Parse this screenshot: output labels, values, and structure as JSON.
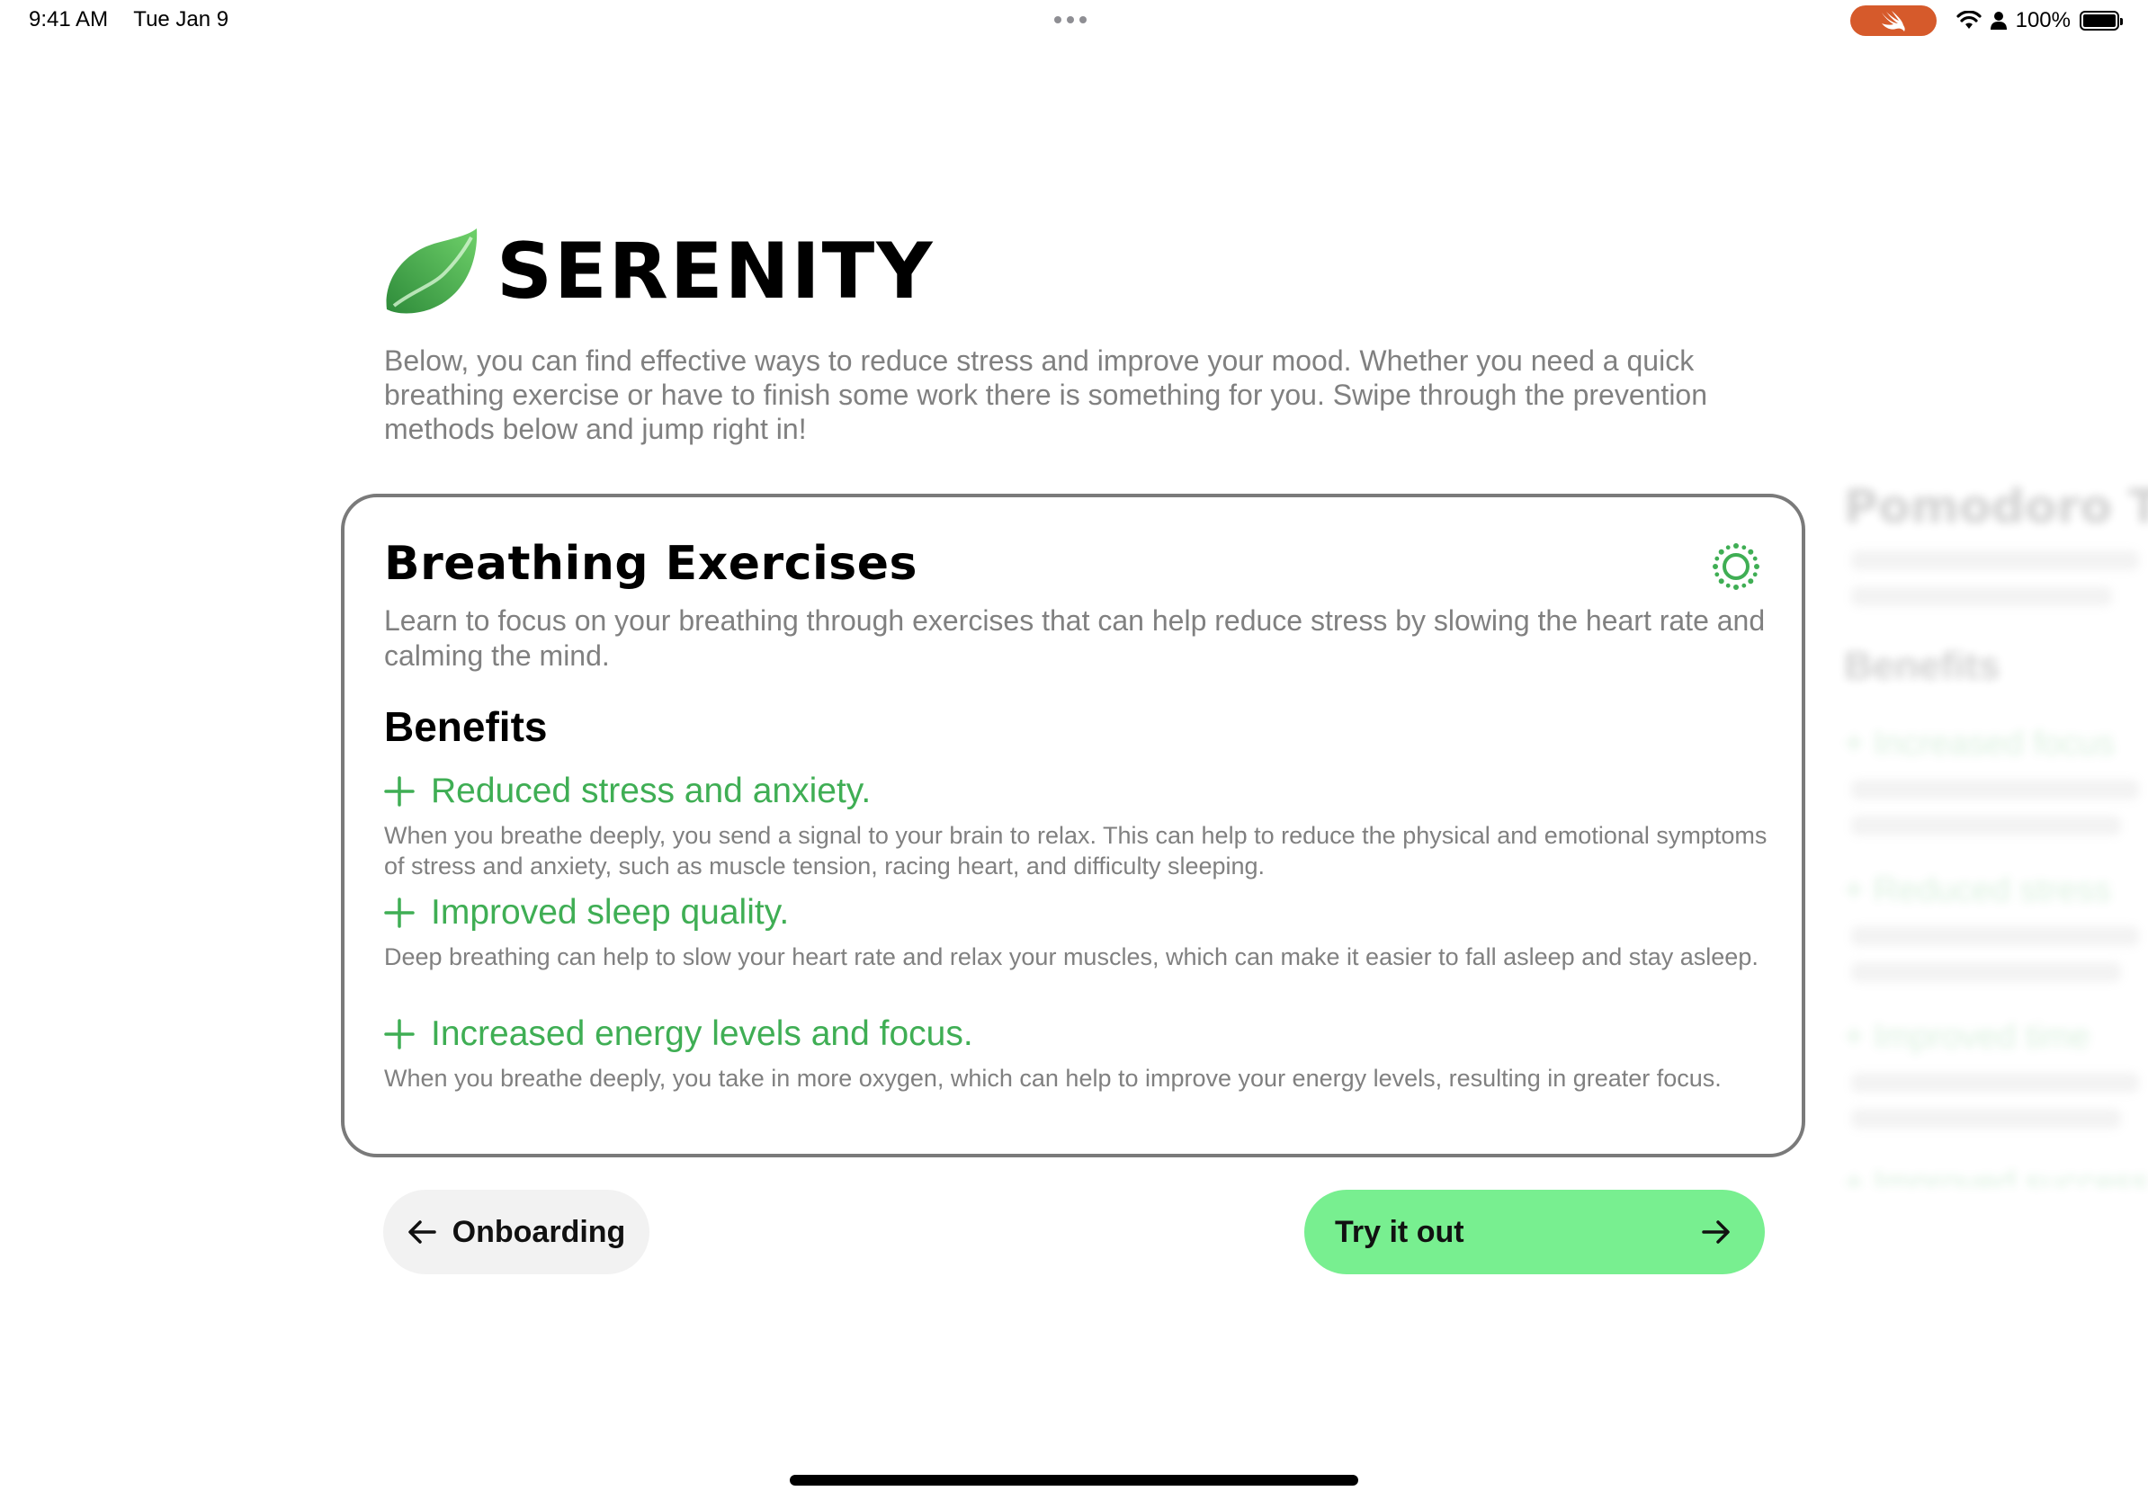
{
  "status_bar": {
    "time": "9:41 AM",
    "date": "Tue Jan 9",
    "battery": "100%"
  },
  "header": {
    "app_name": "SERENITY",
    "intro": "Below, you can find effective ways to reduce stress and improve your mood. Whether you need a quick breathing exercise or have to finish some work there is something for you. Swipe through the prevention methods below and jump right in!"
  },
  "card": {
    "title": "Breathing Exercises",
    "description": "Learn to focus on your breathing through exercises that can help reduce stress by slowing the heart rate and calming the mind.",
    "benefits_heading": "Benefits",
    "benefits": [
      {
        "title": "Reduced stress and anxiety.",
        "text": "When you breathe deeply, you send a signal to your brain to relax. This can help to reduce the physical and emotional symptoms of stress and anxiety, such as muscle tension, racing heart, and difficulty sleeping."
      },
      {
        "title": "Improved sleep quality.",
        "text": "Deep breathing can help to slow your heart rate and relax your muscles, which can make it easier to fall asleep and stay asleep."
      },
      {
        "title": "Increased energy levels and focus.",
        "text": "When you breathe deeply, you take in more oxygen, which can help to improve your energy levels, resulting in greater focus."
      }
    ]
  },
  "buttons": {
    "back_label": "Onboarding",
    "try_label": "Try it out"
  },
  "colors": {
    "accent_green": "#3fae54",
    "button_green": "#78ef90",
    "swift_orange": "#d65a2b"
  },
  "icons": {
    "card_icon": "breathing-sun-icon",
    "logo": "leaf-logo-icon"
  }
}
